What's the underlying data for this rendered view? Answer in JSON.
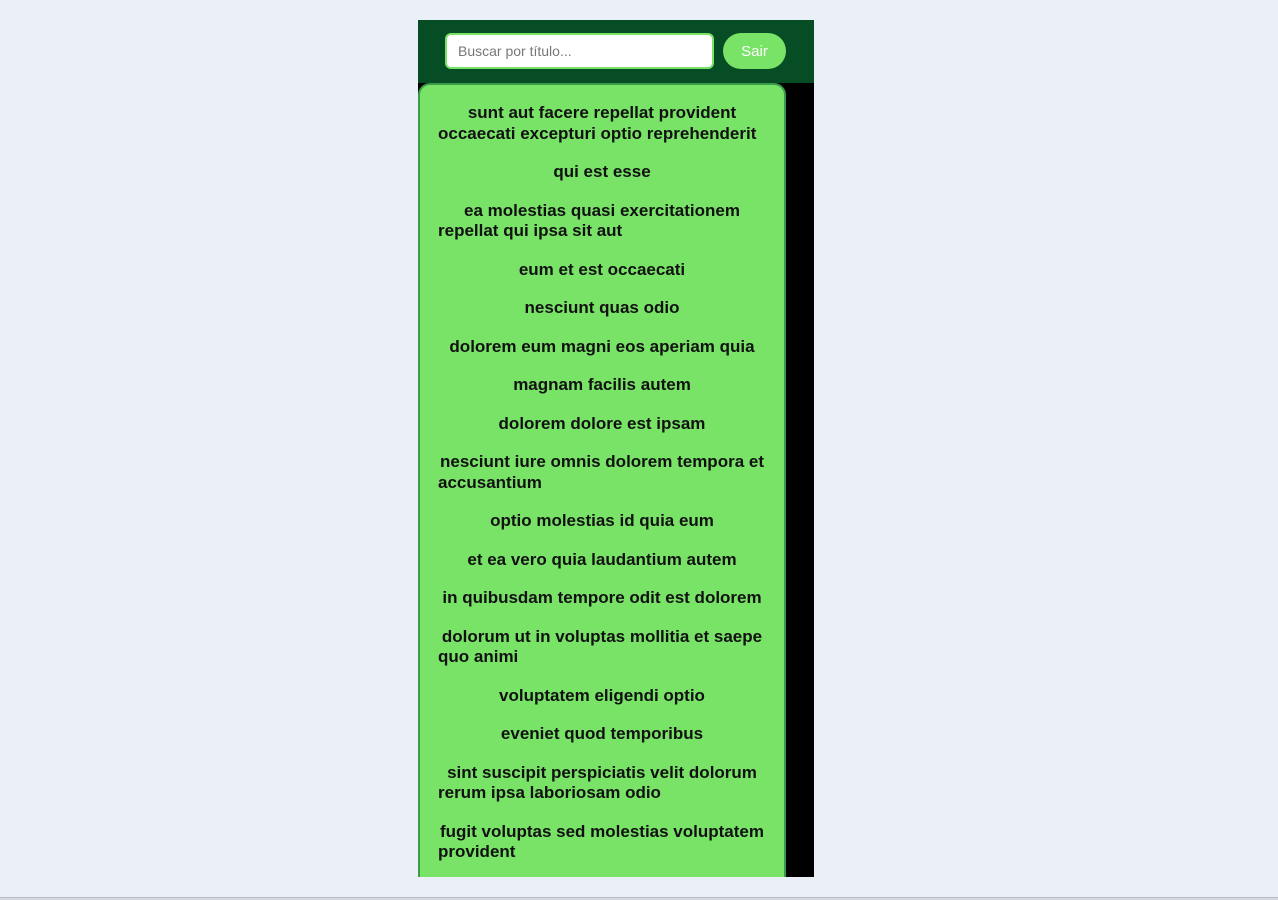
{
  "search": {
    "placeholder": "Buscar por título..."
  },
  "header": {
    "logout_label": "Sair"
  },
  "posts": [
    {
      "title": "sunt aut facere repellat provident occaecati excepturi optio reprehenderit"
    },
    {
      "title": "qui est esse"
    },
    {
      "title": "ea molestias quasi exercitationem repellat qui ipsa sit aut"
    },
    {
      "title": "eum et est occaecati"
    },
    {
      "title": "nesciunt quas odio"
    },
    {
      "title": "dolorem eum magni eos aperiam quia"
    },
    {
      "title": "magnam facilis autem"
    },
    {
      "title": "dolorem dolore est ipsam"
    },
    {
      "title": "nesciunt iure omnis dolorem tempora et accusantium"
    },
    {
      "title": "optio molestias id quia eum"
    },
    {
      "title": "et ea vero quia laudantium autem"
    },
    {
      "title": "in quibusdam tempore odit est dolorem"
    },
    {
      "title": "dolorum ut in voluptas mollitia et saepe quo animi"
    },
    {
      "title": "voluptatem eligendi optio"
    },
    {
      "title": "eveniet quod temporibus"
    },
    {
      "title": "sint suscipit perspiciatis velit dolorum rerum ipsa laboriosam odio"
    },
    {
      "title": "fugit voluptas sed molestias voluptatem provident"
    }
  ],
  "colors": {
    "page_background": "#ebeff8",
    "header_background": "#064c24",
    "accent_green": "#79e368",
    "panel_background": "#000000"
  }
}
